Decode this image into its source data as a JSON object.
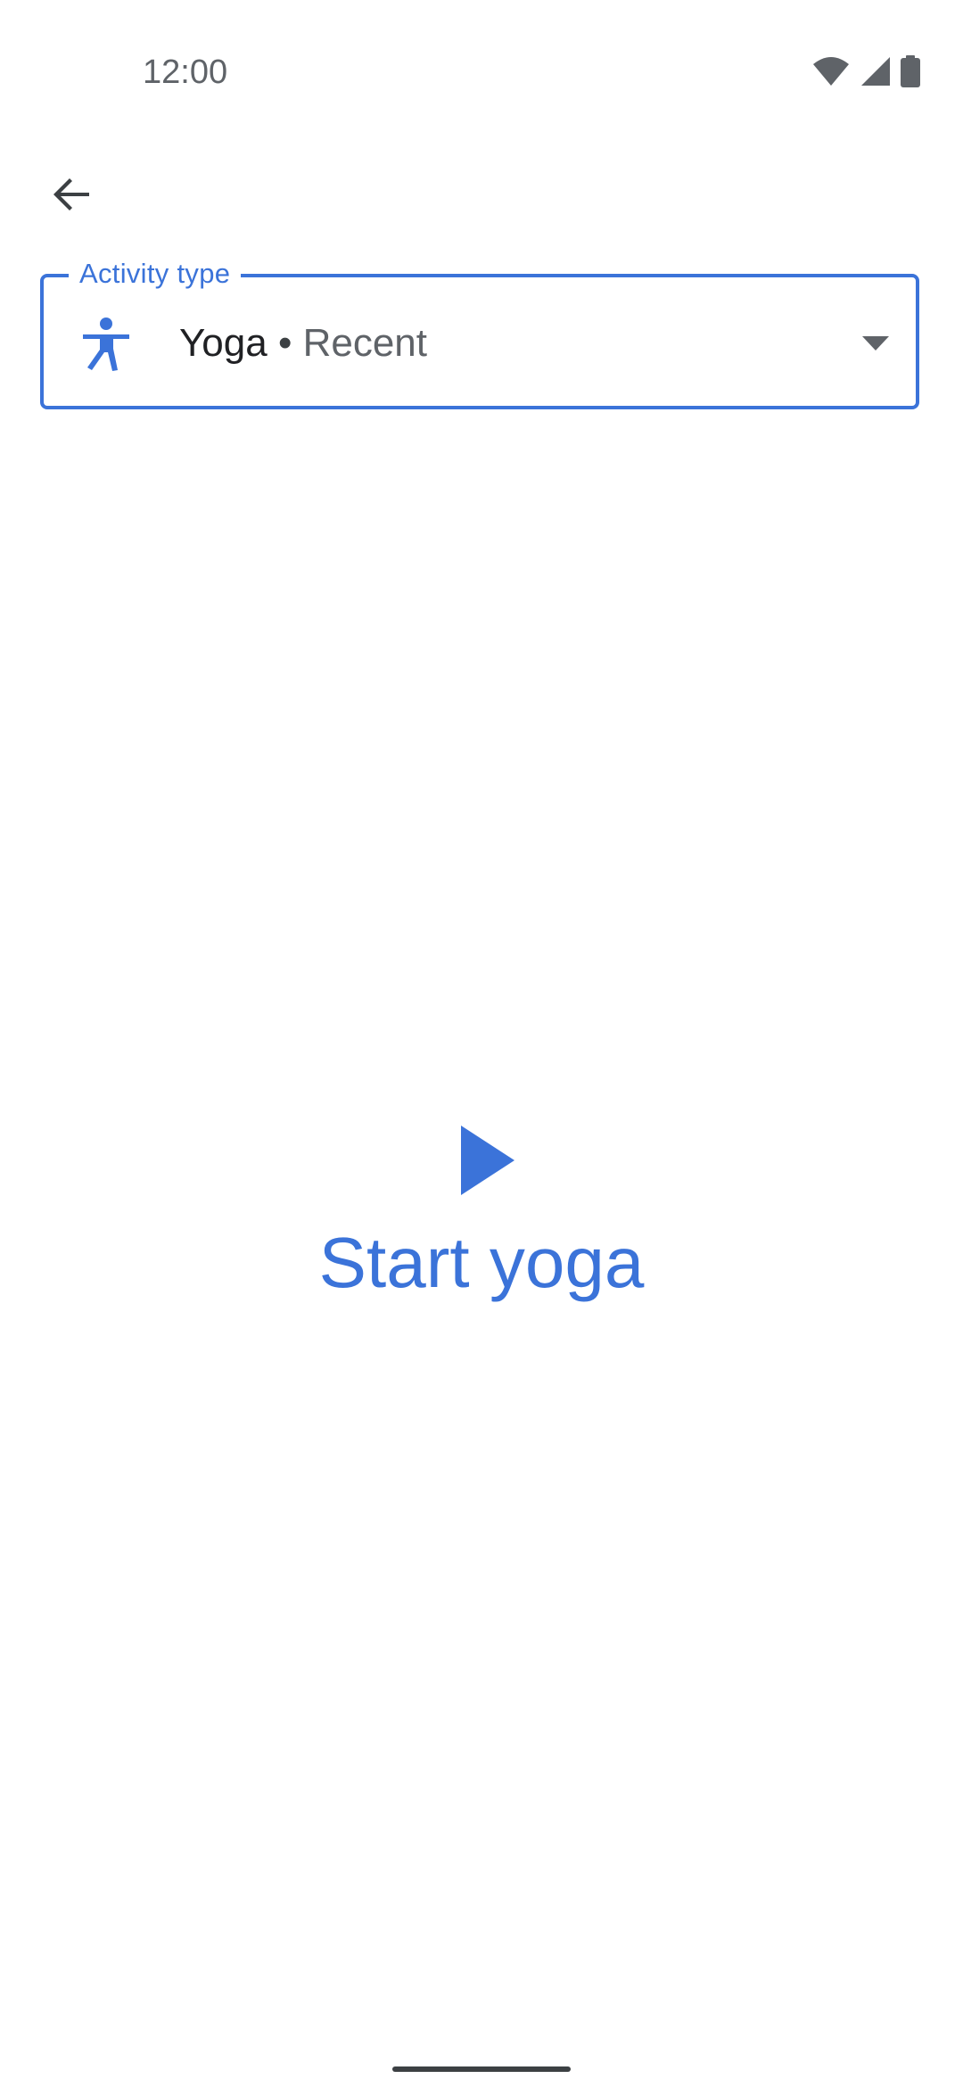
{
  "status_bar": {
    "time": "12:00",
    "icons": [
      "wifi-icon",
      "cellular-signal-icon",
      "battery-icon"
    ]
  },
  "app_bar": {
    "back_icon": "arrow-back-icon"
  },
  "activity_field": {
    "label": "Activity type",
    "icon": "yoga-figure-icon",
    "activity_name": "Yoga",
    "separator": " • ",
    "activity_tag": "Recent",
    "dropdown_icon": "dropdown-arrow-icon"
  },
  "start": {
    "icon": "play-icon",
    "label": "Start yoga"
  },
  "colors": {
    "accent": "#3b73d9",
    "text_primary": "#202124",
    "text_secondary": "#5f6368",
    "background": "#ffffff"
  }
}
